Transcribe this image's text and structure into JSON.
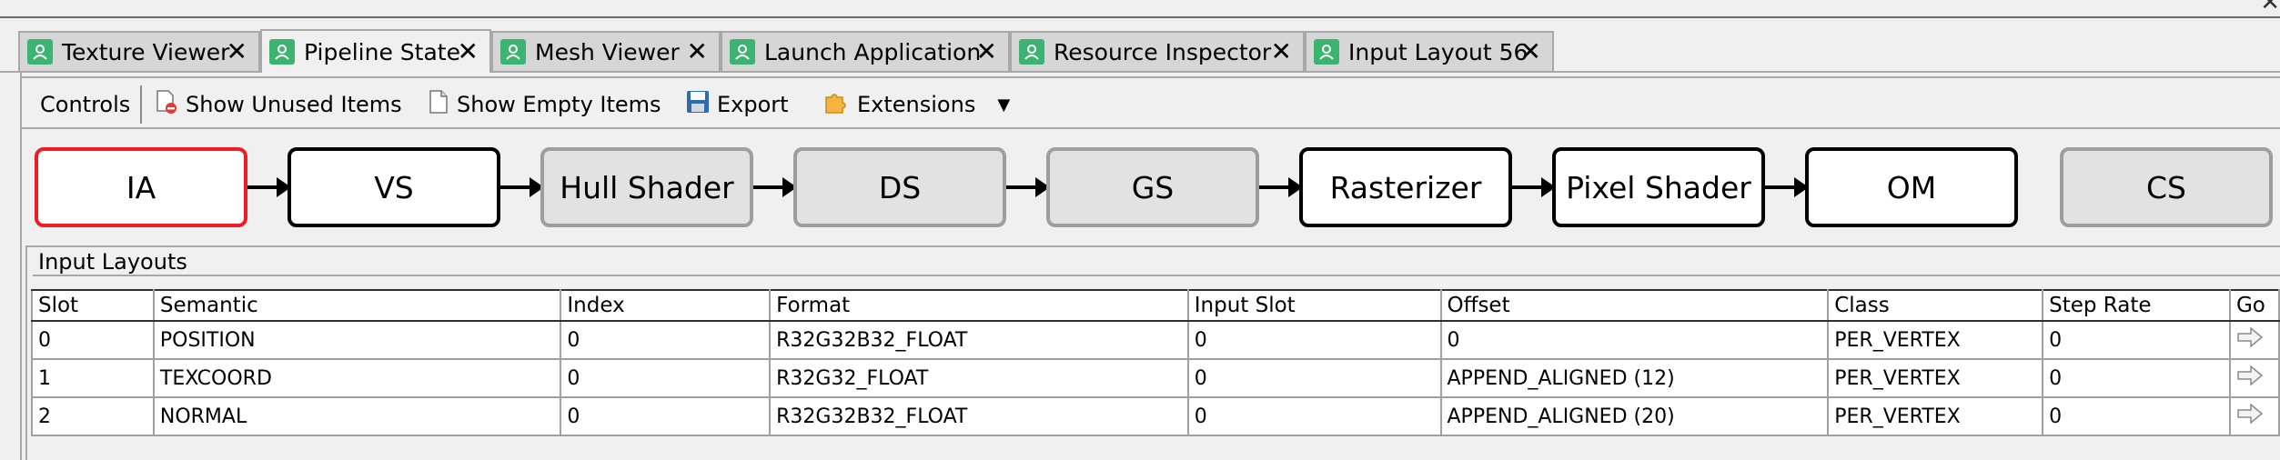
{
  "tabs": [
    {
      "label": "Texture Viewer",
      "active": false
    },
    {
      "label": "Pipeline State",
      "active": true
    },
    {
      "label": "Mesh Viewer",
      "active": false
    },
    {
      "label": "Launch Application",
      "active": false
    },
    {
      "label": "Resource Inspector",
      "active": false
    },
    {
      "label": "Input Layout 56",
      "active": false
    }
  ],
  "toolbar": {
    "controls_label": "Controls",
    "show_unused_label": "Show Unused Items",
    "show_empty_label": "Show Empty Items",
    "export_label": "Export",
    "extensions_label": "Extensions"
  },
  "pipeline": {
    "stages": [
      {
        "label": "IA",
        "state": "selected"
      },
      {
        "label": "VS",
        "state": "active"
      },
      {
        "label": "Hull Shader",
        "state": "inactive"
      },
      {
        "label": "DS",
        "state": "inactive"
      },
      {
        "label": "GS",
        "state": "inactive"
      },
      {
        "label": "Rasterizer",
        "state": "active"
      },
      {
        "label": "Pixel Shader",
        "state": "active"
      },
      {
        "label": "OM",
        "state": "active"
      },
      {
        "label": "CS",
        "state": "inactive"
      }
    ]
  },
  "input_layouts": {
    "title": "Input Layouts",
    "columns": [
      "Slot",
      "Semantic",
      "Index",
      "Format",
      "Input Slot",
      "Offset",
      "Class",
      "Step Rate",
      "Go"
    ],
    "rows": [
      [
        "0",
        "POSITION",
        "0",
        "R32G32B32_FLOAT",
        "0",
        "0",
        "PER_VERTEX",
        "0"
      ],
      [
        "1",
        "TEXCOORD",
        "0",
        "R32G32_FLOAT",
        "0",
        "APPEND_ALIGNED (12)",
        "PER_VERTEX",
        "0"
      ],
      [
        "2",
        "NORMAL",
        "0",
        "R32G32B32_FLOAT",
        "0",
        "APPEND_ALIGNED (20)",
        "PER_VERTEX",
        "0"
      ]
    ]
  },
  "colors": {
    "tab_icon": "#3cb371",
    "selected_stage_border": "#ee1c24",
    "inactive_stage_bg": "#e2e2e2"
  }
}
